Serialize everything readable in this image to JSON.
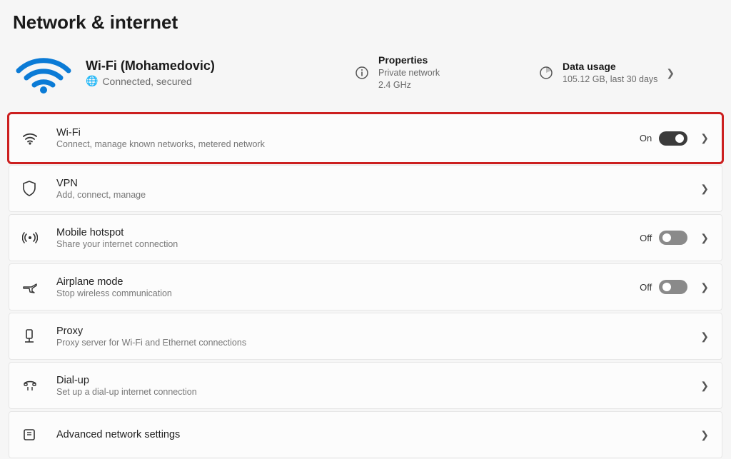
{
  "page_title": "Network & internet",
  "connection": {
    "name": "Wi-Fi (Mohamedovic)",
    "status": "Connected, secured"
  },
  "properties_card": {
    "title": "Properties",
    "line1": "Private network",
    "line2": "2.4 GHz"
  },
  "data_usage_card": {
    "title": "Data usage",
    "line1": "105.12 GB, last 30 days"
  },
  "items": [
    {
      "icon": "wifi",
      "title": "Wi-Fi",
      "sub": "Connect, manage known networks, metered network",
      "toggle": {
        "state": "On",
        "on": true
      },
      "highlight": true
    },
    {
      "icon": "shield",
      "title": "VPN",
      "sub": "Add, connect, manage",
      "toggle": null,
      "highlight": false
    },
    {
      "icon": "hotspot",
      "title": "Mobile hotspot",
      "sub": "Share your internet connection",
      "toggle": {
        "state": "Off",
        "on": false
      },
      "highlight": false
    },
    {
      "icon": "airplane",
      "title": "Airplane mode",
      "sub": "Stop wireless communication",
      "toggle": {
        "state": "Off",
        "on": false
      },
      "highlight": false
    },
    {
      "icon": "proxy",
      "title": "Proxy",
      "sub": "Proxy server for Wi-Fi and Ethernet connections",
      "toggle": null,
      "highlight": false
    },
    {
      "icon": "dialup",
      "title": "Dial-up",
      "sub": "Set up a dial-up internet connection",
      "toggle": null,
      "highlight": false
    },
    {
      "icon": "advanced",
      "title": "Advanced network settings",
      "sub": "",
      "toggle": null,
      "highlight": false
    }
  ]
}
